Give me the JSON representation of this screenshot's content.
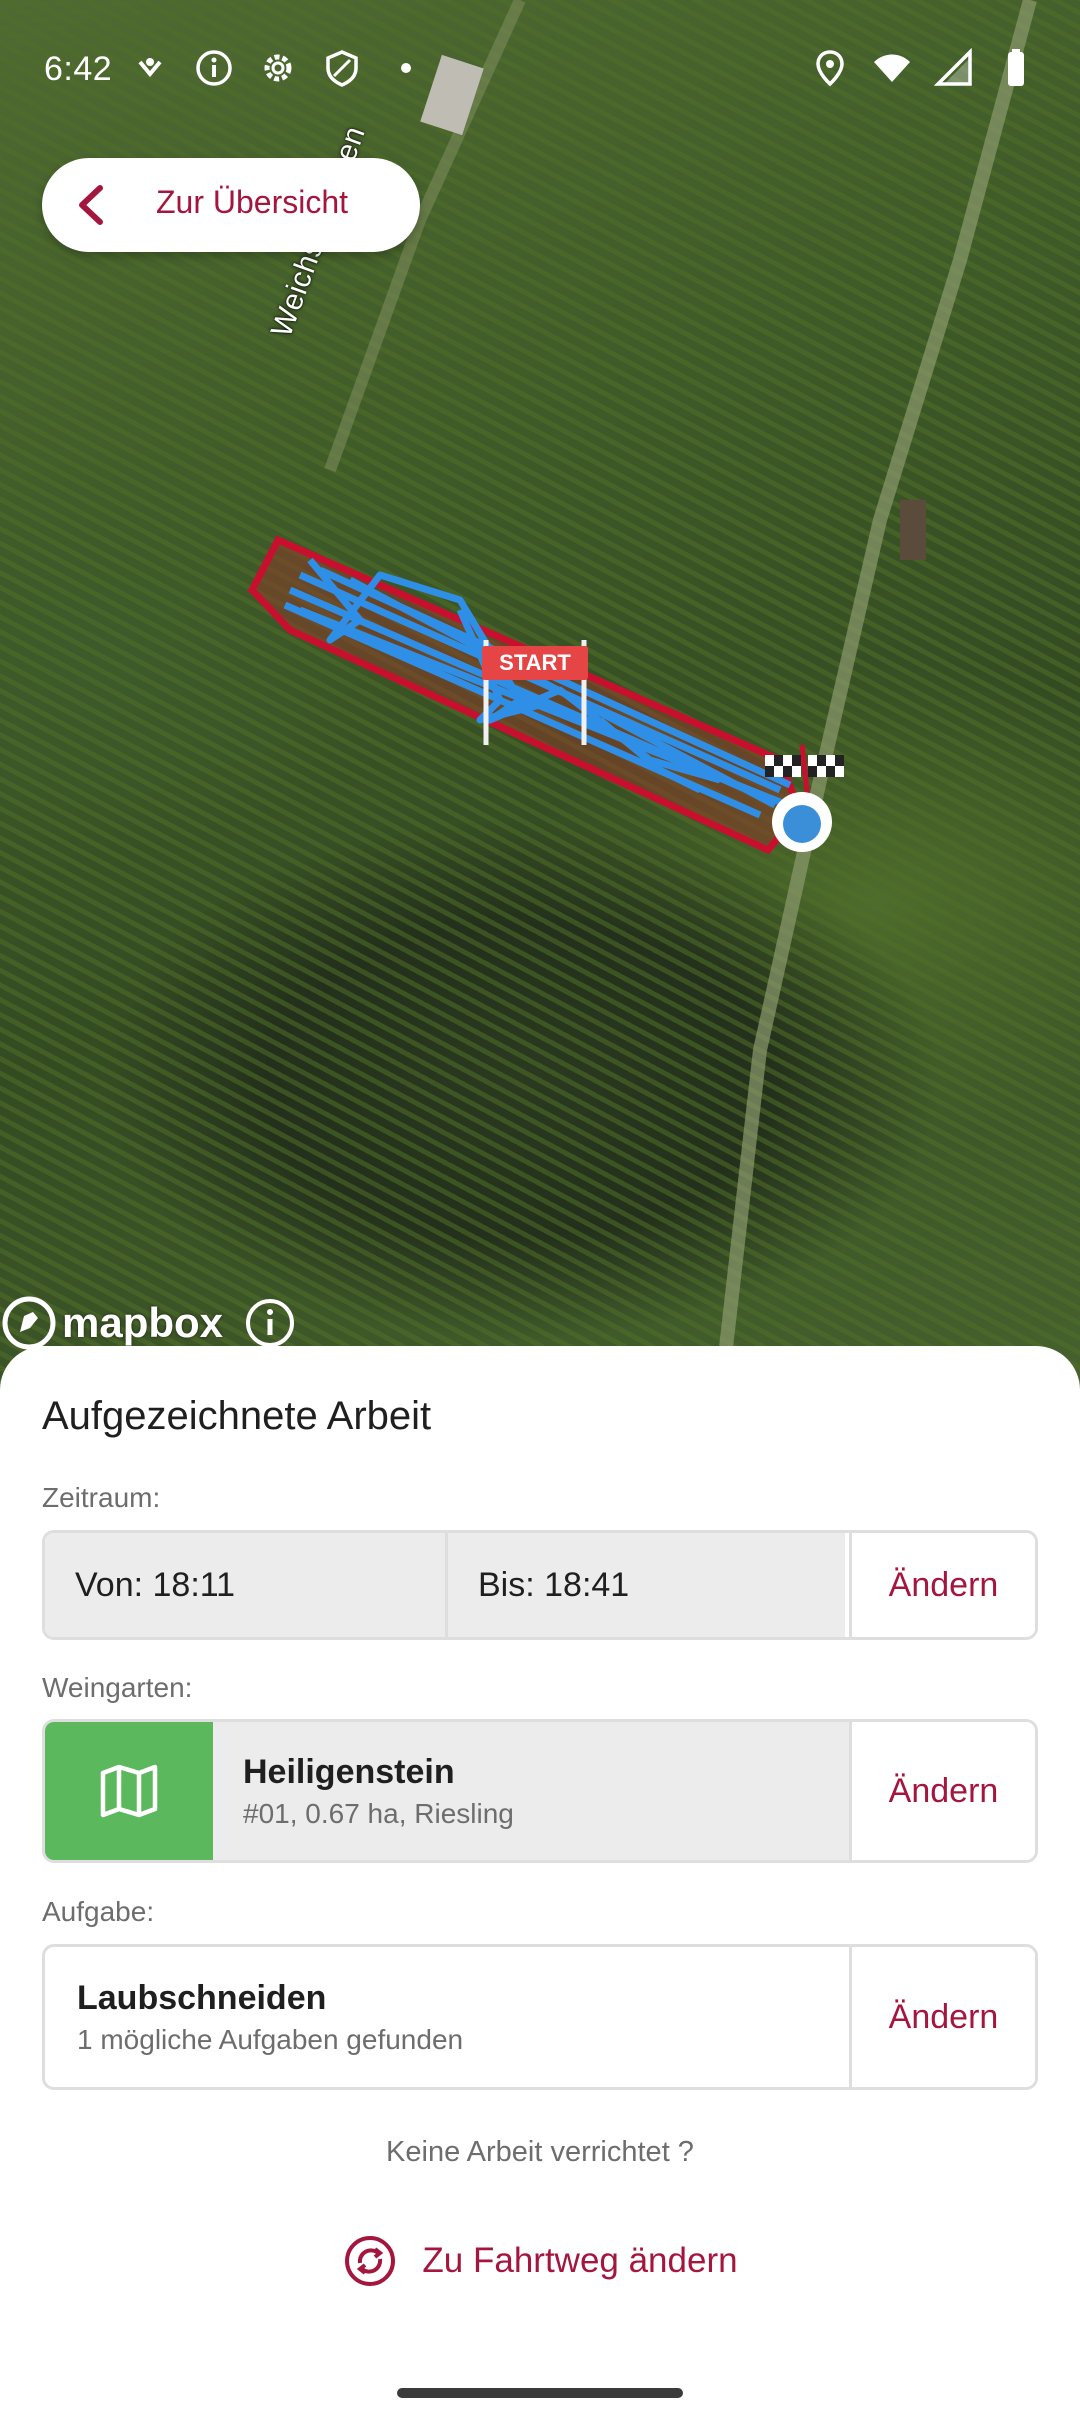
{
  "status_bar": {
    "time": "6:42"
  },
  "map": {
    "back_label": "Zur Übersicht",
    "street_name": "Weichselgraben",
    "start_sign": "START",
    "attribution": "mapbox",
    "track_color": "#2f8fe6",
    "field_border_color": "#c8102e"
  },
  "sheet": {
    "title": "Aufgezeichnete Arbeit",
    "time_section": {
      "label": "Zeitraum:",
      "from": "Von: 18:11",
      "to": "Bis: 18:41",
      "change": "Ändern"
    },
    "vineyard_section": {
      "label": "Weingarten:",
      "name": "Heiligenstein",
      "meta": "#01, 0.67 ha, Riesling",
      "change": "Ändern",
      "icon_color": "#5cb85c"
    },
    "task_section": {
      "label": "Aufgabe:",
      "name": "Laubschneiden",
      "meta": "1 mögliche Aufgaben gefunden",
      "change": "Ändern"
    },
    "no_work": "Keine Arbeit verrichtet ?",
    "route_button": "Zu Fahrtweg ändern"
  },
  "colors": {
    "accent": "#a5163f",
    "border": "#dedede",
    "grey_cell": "#ececec"
  }
}
